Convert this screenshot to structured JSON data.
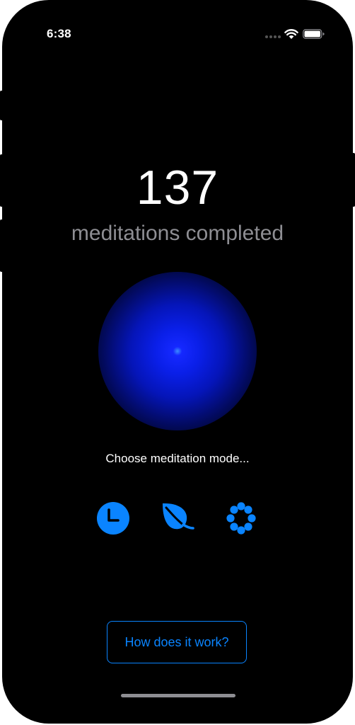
{
  "status_bar": {
    "time": "6:38",
    "signal_icon": "cellular-signal-icon",
    "wifi_icon": "wifi-icon",
    "battery_icon": "battery-icon"
  },
  "stats": {
    "count": "137",
    "label": "meditations completed"
  },
  "orb": {
    "core_color": "#3b8cff",
    "glow_color": "#0a1fe8"
  },
  "mode_selector": {
    "prompt": "Choose meditation mode...",
    "modes": [
      {
        "icon": "clock-icon"
      },
      {
        "icon": "leaf-icon"
      },
      {
        "icon": "flower-icon"
      }
    ]
  },
  "help": {
    "button_label": "How does it work?"
  },
  "colors": {
    "accent": "#0a84ff",
    "background": "#000000",
    "secondary_text": "#8e8e93"
  }
}
